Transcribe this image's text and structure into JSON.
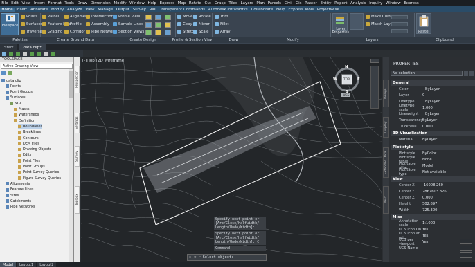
{
  "menubar": {
    "items": [
      "File",
      "Edit",
      "View",
      "Insert",
      "Format",
      "Tools",
      "Draw",
      "Dimension",
      "Modify",
      "Window",
      "Help",
      "Express",
      "Map",
      "Rotate",
      "Cut",
      "Grasp",
      "Tiles",
      "Layers",
      "Plan",
      "Parcels",
      "Civil",
      "Gis",
      "Raster",
      "Entity",
      "Report",
      "Analysis",
      "Inquiry",
      "Window",
      "Express"
    ]
  },
  "tabs": {
    "items": [
      "Home",
      "Insert",
      "Annotate",
      "Modify",
      "Analyze",
      "View",
      "Manage",
      "Output",
      "Survey",
      "Rail",
      "Transparent Commands",
      "Autodesk InfraWorks",
      "Collaborate",
      "Help",
      "Express Tools",
      "ProjectWise"
    ],
    "active_index": 0
  },
  "ribbon": {
    "toolspace_label": "Toolspace",
    "c1": [
      "Points",
      "Surfaces",
      "Traverse"
    ],
    "c2": [
      "Parcel",
      "Feature Line",
      "Grading"
    ],
    "c3": [
      "Alignment",
      "Profile",
      "Corridor"
    ],
    "c4": [
      "Intersections",
      "Assembly",
      "Pipe Network"
    ],
    "c5": [
      "Profile View",
      "Sample Lines",
      "Section Views"
    ],
    "c6": [
      "Move",
      "Copy",
      "Stretch"
    ],
    "c7": [
      "Rotate",
      "Mirror",
      "Scale"
    ],
    "c8": [
      "Trim",
      "Fillet",
      "Array"
    ],
    "layer_properties": "Layer Properties",
    "c9": [
      "Make Current",
      "Match Layer"
    ],
    "paste_label": "Paste",
    "panels": [
      "Palettes",
      "Create Ground Data",
      "Create Design",
      "Profile & Section Views",
      "Draw",
      "Modify",
      "Layers",
      "Clipboard"
    ]
  },
  "doctabs": {
    "items": [
      "Start",
      "data clip*"
    ],
    "active_index": 1
  },
  "viewport_label": "[-][Top][2D Wireframe]",
  "toolspace": {
    "header": "TOOLSPACE",
    "view_select": "Active Drawing View",
    "tree": [
      {
        "label": "data clip",
        "indent": 0
      },
      {
        "label": "Points",
        "indent": 1
      },
      {
        "label": "Point Groups",
        "indent": 1
      },
      {
        "label": "Surfaces",
        "indent": 1
      },
      {
        "label": "NGL",
        "indent": 2
      },
      {
        "label": "Masks",
        "indent": 3
      },
      {
        "label": "Watersheds",
        "indent": 3
      },
      {
        "label": "Definition",
        "indent": 3
      },
      {
        "label": "Boundaries",
        "indent": 4,
        "selected": true
      },
      {
        "label": "Breaklines",
        "indent": 4
      },
      {
        "label": "Contours",
        "indent": 4
      },
      {
        "label": "DEM Files",
        "indent": 4
      },
      {
        "label": "Drawing Objects",
        "indent": 4
      },
      {
        "label": "Edits",
        "indent": 4
      },
      {
        "label": "Point Files",
        "indent": 4
      },
      {
        "label": "Point Groups",
        "indent": 4
      },
      {
        "label": "Point Survey Queries",
        "indent": 4
      },
      {
        "label": "Figure Survey Queries",
        "indent": 4
      },
      {
        "label": "Alignments",
        "indent": 1
      },
      {
        "label": "Feature Lines",
        "indent": 1
      },
      {
        "label": "Sites",
        "indent": 1
      },
      {
        "label": "Catchments",
        "indent": 1
      },
      {
        "label": "Pipe Networks",
        "indent": 1
      }
    ],
    "vtabs": [
      "Prospector",
      "Settings",
      "Survey",
      "Toolbox"
    ]
  },
  "viewcube": {
    "N": "N",
    "S": "S",
    "E": "E",
    "W": "W",
    "top": "TOP",
    "wcs": "WCS"
  },
  "commandlog": [
    "Specify next point or\n[Arc/Close/Halfwidth/\nLength/Undo/Width]:",
    "Specify next point or\n[Arc/Close/Halfwidth/\nLength/Undo/Width]: C",
    "Command:"
  ],
  "command_prompt": "Select object:",
  "properties": {
    "title": "PROPERTIES",
    "selection": "No selection",
    "vtabs": [
      "Design",
      "Display",
      "Extended Data",
      "Misc"
    ],
    "sections": [
      {
        "name": "General",
        "rows": [
          [
            "Color",
            "ByLayer"
          ],
          [
            "Layer",
            "0"
          ],
          [
            "Linetype",
            "ByLayer"
          ],
          [
            "Linetype scale",
            "1.000"
          ],
          [
            "Lineweight",
            "ByLayer"
          ],
          [
            "Transparency",
            "ByLayer"
          ],
          [
            "Thickness",
            "0.000"
          ]
        ]
      },
      {
        "name": "3D Visualization",
        "rows": [
          [
            "Material",
            "ByLayer"
          ]
        ]
      },
      {
        "name": "Plot style",
        "rows": [
          [
            "Plot style",
            "ByColor"
          ],
          [
            "Plot style table",
            "None"
          ],
          [
            "Plot table attac...",
            "Model"
          ],
          [
            "Plot table type",
            "Not available"
          ]
        ]
      },
      {
        "name": "View",
        "rows": [
          [
            "Center X",
            "-16008.260"
          ],
          [
            "Center Y",
            "2867603.826"
          ],
          [
            "Center Z",
            "0.000"
          ],
          [
            "Height",
            "502.897"
          ],
          [
            "Width",
            "725.300"
          ]
        ]
      },
      {
        "name": "Misc",
        "rows": [
          [
            "Annotation scale",
            "1:1000"
          ],
          [
            "UCS icon On",
            "Yes"
          ],
          [
            "UCS icon at ori...",
            "Yes"
          ],
          [
            "UCS per viewport",
            "Yes"
          ],
          [
            "UCS Name",
            ""
          ]
        ]
      }
    ]
  },
  "statusbar": {
    "tabs": [
      "Model",
      "Layout1",
      "Layout2"
    ],
    "active_index": 0
  }
}
